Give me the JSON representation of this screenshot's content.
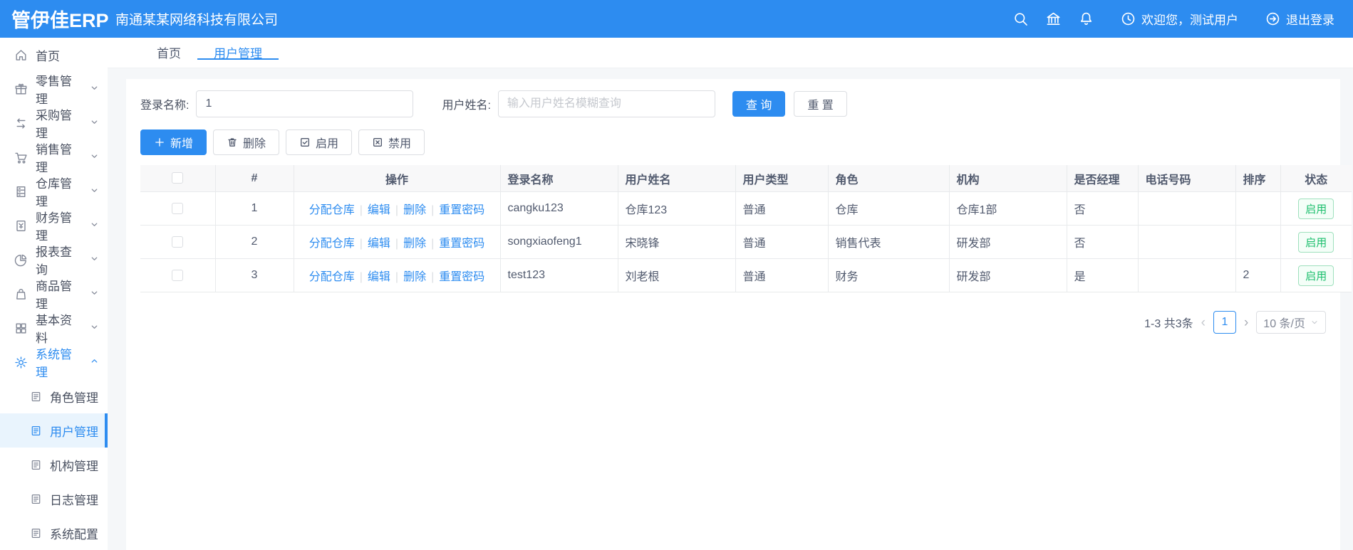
{
  "colors": {
    "primary": "#2d8cf0",
    "success": "#19be6b"
  },
  "header": {
    "logo": "管伊佳ERP",
    "company": "南通某某网络科技有限公司",
    "welcome_text": "欢迎您，测试用户",
    "logout_text": "退出登录"
  },
  "tabs": {
    "home": "首页",
    "current": "用户管理"
  },
  "sidebar": {
    "items": [
      {
        "label": "首页"
      },
      {
        "label": "零售管理"
      },
      {
        "label": "采购管理"
      },
      {
        "label": "销售管理"
      },
      {
        "label": "仓库管理"
      },
      {
        "label": "财务管理"
      },
      {
        "label": "报表查询"
      },
      {
        "label": "商品管理"
      },
      {
        "label": "基本资料"
      },
      {
        "label": "系统管理"
      }
    ],
    "system_children": [
      {
        "label": "角色管理"
      },
      {
        "label": "用户管理"
      },
      {
        "label": "机构管理"
      },
      {
        "label": "日志管理"
      },
      {
        "label": "系统配置"
      }
    ]
  },
  "search_form": {
    "login_label": "登录名称:",
    "login_value": "1",
    "name_label": "用户姓名:",
    "name_placeholder": "输入用户姓名模糊查询",
    "search_btn": "查 询",
    "reset_btn": "重 置"
  },
  "toolbar": {
    "add_btn": "新增",
    "delete_btn": "删除",
    "enable_btn": "启用",
    "disable_btn": "禁用"
  },
  "table": {
    "headers": {
      "index": "#",
      "actions": "操作",
      "login": "登录名称",
      "name": "用户姓名",
      "type": "用户类型",
      "role": "角色",
      "org": "机构",
      "manager": "是否经理",
      "phone": "电话号码",
      "sort": "排序",
      "status": "状态"
    },
    "action_links": {
      "assign": "分配仓库",
      "edit": "编辑",
      "del": "删除",
      "reset": "重置密码"
    },
    "rows": [
      {
        "index": "1",
        "login": "cangku123",
        "name": "仓库123",
        "type": "普通",
        "role": "仓库",
        "org": "仓库1部",
        "manager": "否",
        "phone": "",
        "sort": "",
        "status": "启用"
      },
      {
        "index": "2",
        "login": "songxiaofeng1",
        "name": "宋晓锋",
        "type": "普通",
        "role": "销售代表",
        "org": "研发部",
        "manager": "否",
        "phone": "",
        "sort": "",
        "status": "启用"
      },
      {
        "index": "3",
        "login": "test123",
        "name": "刘老根",
        "type": "普通",
        "role": "财务",
        "org": "研发部",
        "manager": "是",
        "phone": "",
        "sort": "2",
        "status": "启用"
      }
    ]
  },
  "pagination": {
    "total": "1-3 共3条",
    "current_page": "1",
    "page_size": "10 条/页"
  }
}
